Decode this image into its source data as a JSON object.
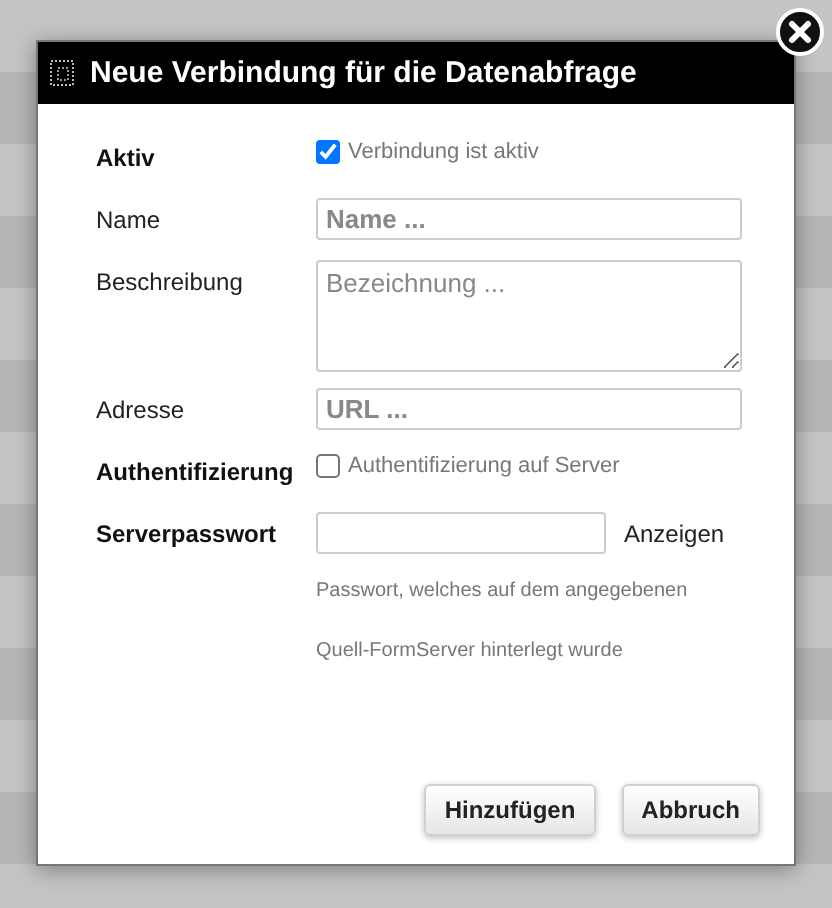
{
  "dialog": {
    "title": "Neue Verbindung für die Datenabfrage",
    "fields": [
      {
        "kind": "checkbox",
        "label": "Aktiv",
        "bold": true,
        "checked": true,
        "text": "Verbindung ist aktiv"
      },
      {
        "kind": "text",
        "label": "Name",
        "bold": false,
        "placeholder": "Name ..."
      },
      {
        "kind": "textarea",
        "label": "Beschreibung",
        "bold": false,
        "placeholder": "Bezeichnung ..."
      },
      {
        "kind": "text",
        "label": "Adresse",
        "bold": false,
        "placeholder": "URL ..."
      },
      {
        "kind": "checkbox",
        "label": "Authentifizierung",
        "bold": true,
        "checked": false,
        "text": "Authentifizierung auf Server"
      },
      {
        "kind": "password",
        "label": "Serverpasswort",
        "bold": true,
        "toggle": "Anzeigen",
        "hints": [
          "Passwort, welches auf dem angegebenen",
          "Quell-FormServer hinterlegt wurde"
        ]
      }
    ],
    "buttons": [
      "Hinzufügen",
      "Abbruch"
    ]
  }
}
